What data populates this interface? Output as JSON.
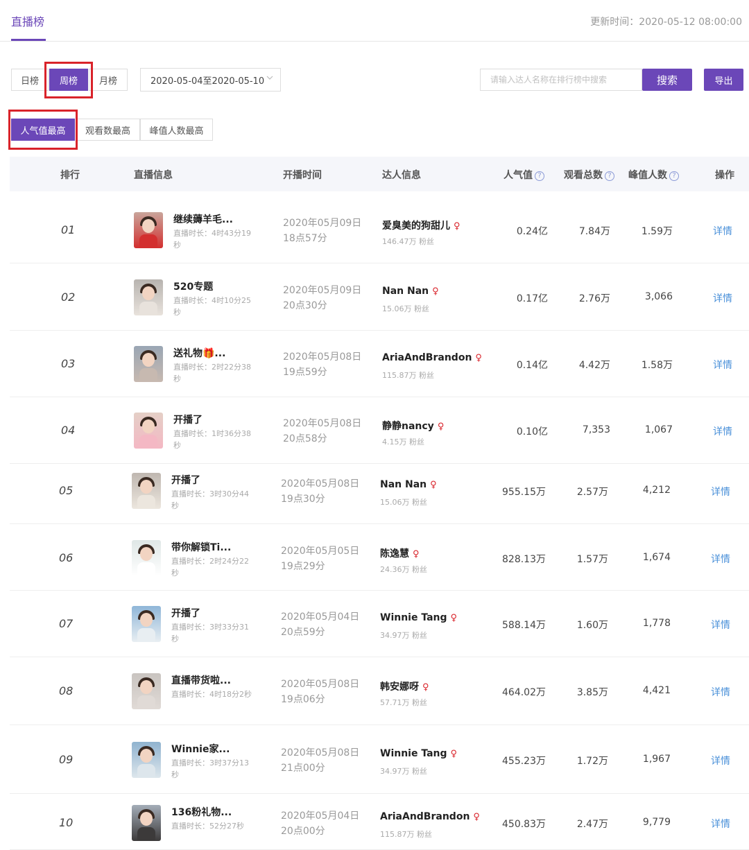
{
  "header": {
    "page_tab": "直播榜",
    "update_label": "更新时间：2020-05-12 08:00:00"
  },
  "period_tabs": [
    {
      "label": "日榜",
      "active": false
    },
    {
      "label": "周榜",
      "active": true
    },
    {
      "label": "月榜",
      "active": false
    }
  ],
  "date_range": "2020-05-04至2020-05-10",
  "search": {
    "placeholder": "请输入达人名称在排行榜中搜索",
    "button": "搜索"
  },
  "export_button": "导出",
  "sort_tabs": [
    {
      "label": "人气值最高",
      "active": true
    },
    {
      "label": "观看数最高",
      "active": false
    },
    {
      "label": "峰值人数最高",
      "active": false
    }
  ],
  "columns": {
    "rank": "排行",
    "live_info": "直播信息",
    "start_time": "开播时间",
    "kol_info": "达人信息",
    "popularity": "人气值",
    "total_views": "观看总数",
    "peak_viewers": "峰值人数",
    "action": "操作"
  },
  "rows": [
    {
      "rank": "01",
      "title": "继续薅羊毛...",
      "duration": "直播时长：4时43分19秒",
      "start_date": "2020年05月09日",
      "start_clock": "18点57分",
      "kol": "爱臭美的狗甜儿",
      "fans": "146.47万 粉丝",
      "popularity": "0.24亿",
      "views": "7.84万",
      "peak": "1.59万",
      "action": "详情"
    },
    {
      "rank": "02",
      "title": "520专题",
      "duration": "直播时长：4时10分25秒",
      "start_date": "2020年05月09日",
      "start_clock": "20点30分",
      "kol": "Nan Nan",
      "fans": "15.06万 粉丝",
      "popularity": "0.17亿",
      "views": "2.76万",
      "peak": "3,066",
      "action": "详情"
    },
    {
      "rank": "03",
      "title": "送礼物🎁...",
      "duration": "直播时长：2时22分38秒",
      "start_date": "2020年05月08日",
      "start_clock": "19点59分",
      "kol": "AriaAndBrandon",
      "fans": "115.87万 粉丝",
      "popularity": "0.14亿",
      "views": "4.42万",
      "peak": "1.58万",
      "action": "详情"
    },
    {
      "rank": "04",
      "title": "开播了",
      "duration": "直播时长：1时36分38秒",
      "start_date": "2020年05月08日",
      "start_clock": "20点58分",
      "kol": "静静nancy",
      "fans": "4.15万 粉丝",
      "popularity": "0.10亿",
      "views": "7,353",
      "peak": "1,067",
      "action": "详情"
    },
    {
      "rank": "05",
      "title": "开播了",
      "duration": "直播时长：3时30分44秒",
      "start_date": "2020年05月08日",
      "start_clock": "19点30分",
      "kol": "Nan Nan",
      "fans": "15.06万 粉丝",
      "popularity": "955.15万",
      "views": "2.57万",
      "peak": "4,212",
      "action": "详情"
    },
    {
      "rank": "06",
      "title": "带你解锁Ti...",
      "duration": "直播时长：2时24分22秒",
      "start_date": "2020年05月05日",
      "start_clock": "19点29分",
      "kol": "陈逸慧",
      "fans": "24.36万 粉丝",
      "popularity": "828.13万",
      "views": "1.57万",
      "peak": "1,674",
      "action": "详情"
    },
    {
      "rank": "07",
      "title": "开播了",
      "duration": "直播时长：3时33分31秒",
      "start_date": "2020年05月04日",
      "start_clock": "20点59分",
      "kol": "Winnie Tang",
      "fans": "34.97万 粉丝",
      "popularity": "588.14万",
      "views": "1.60万",
      "peak": "1,778",
      "action": "详情"
    },
    {
      "rank": "08",
      "title": "直播带货啦...",
      "duration": "直播时长：4时18分2秒",
      "start_date": "2020年05月08日",
      "start_clock": "19点06分",
      "kol": "韩安娜呀",
      "fans": "57.71万 粉丝",
      "popularity": "464.02万",
      "views": "3.85万",
      "peak": "4,421",
      "action": "详情"
    },
    {
      "rank": "09",
      "title": "Winnie家...",
      "duration": "直播时长：3时37分13秒",
      "start_date": "2020年05月08日",
      "start_clock": "21点00分",
      "kol": "Winnie Tang",
      "fans": "34.97万 粉丝",
      "popularity": "455.23万",
      "views": "1.72万",
      "peak": "1,967",
      "action": "详情"
    },
    {
      "rank": "10",
      "title": "136粉礼物...",
      "duration": "直播时长：52分27秒",
      "start_date": "2020年05月04日",
      "start_clock": "20点00分",
      "kol": "AriaAndBrandon",
      "fans": "115.87万 粉丝",
      "popularity": "450.83万",
      "views": "2.47万",
      "peak": "9,779",
      "action": "详情"
    }
  ],
  "colors": {
    "accent": "#6b47b8",
    "highlight_box": "#d9232a",
    "link": "#4a90d9",
    "female_icon": "#d9232a"
  }
}
